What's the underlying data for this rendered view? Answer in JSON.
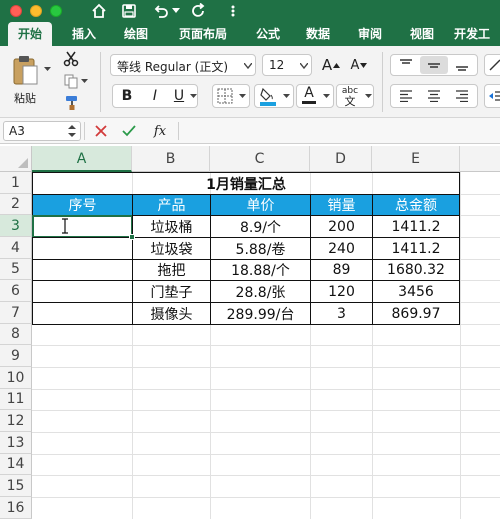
{
  "ribbon": {
    "tabs": [
      "开始",
      "插入",
      "绘图",
      "页面布局",
      "公式",
      "数据",
      "审阅",
      "视图",
      "开发工"
    ],
    "active_tab": "开始",
    "paste_label": "粘贴",
    "font_name": "等线 Regular (正文)",
    "font_size": "12",
    "bold": "B",
    "italic": "I",
    "underline": "U",
    "grow_font": "A",
    "shrink_font": "A",
    "font_color_glyph": "A",
    "abc_glyph": "abc"
  },
  "formula_bar": {
    "name_box": "A3",
    "fx": "fx",
    "value": ""
  },
  "grid": {
    "columns": [
      "A",
      "B",
      "C",
      "D",
      "E"
    ],
    "rows": [
      "1",
      "2",
      "3",
      "4",
      "5",
      "6",
      "7",
      "8",
      "9",
      "10",
      "11",
      "12",
      "13",
      "14",
      "15",
      "16"
    ],
    "selected_cell": "A3"
  },
  "sheet": {
    "title": "1月销量汇总",
    "headers": [
      "序号",
      "产品",
      "单价",
      "销量",
      "总金额"
    ],
    "rows": [
      [
        "",
        "垃圾桶",
        "8.9/个",
        "200",
        "1411.2"
      ],
      [
        "",
        "垃圾袋",
        "5.88/卷",
        "240",
        "1411.2"
      ],
      [
        "",
        "拖把",
        "18.88/个",
        "89",
        "1680.32"
      ],
      [
        "",
        "门垫子",
        "28.8/张",
        "120",
        "3456"
      ],
      [
        "",
        "摄像头",
        "289.99/台",
        "3",
        "869.97"
      ]
    ]
  },
  "colors": {
    "excel_green": "#1f7145",
    "header_blue": "#1aa0e0"
  }
}
